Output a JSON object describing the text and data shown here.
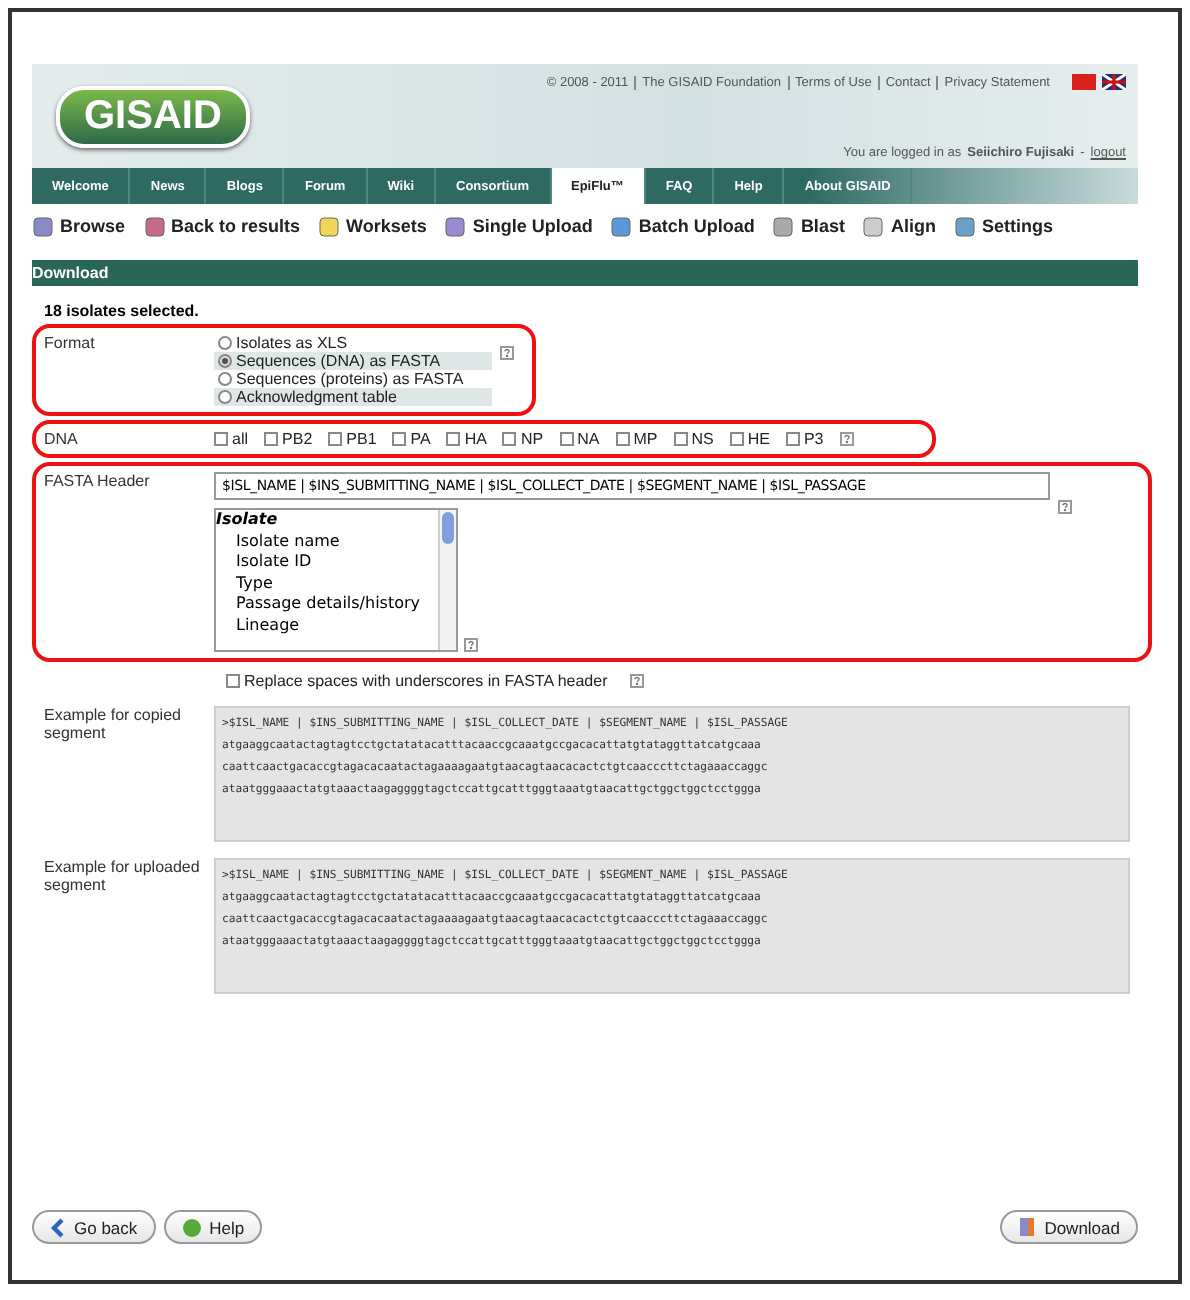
{
  "header": {
    "logo": "GISAID",
    "copyright": "© 2008 - 2011",
    "links": [
      "The GISAID Foundation",
      "Terms of Use",
      "Contact",
      "Privacy Statement"
    ],
    "login_prefix": "You are logged in as",
    "user": "Seiichiro Fujisaki",
    "login_separator": "-",
    "logout": "logout"
  },
  "nav_tabs": [
    {
      "label": "Welcome",
      "selected": false
    },
    {
      "label": "News",
      "selected": false
    },
    {
      "label": "Blogs",
      "selected": false
    },
    {
      "label": "Forum",
      "selected": false
    },
    {
      "label": "Wiki",
      "selected": false
    },
    {
      "label": "Consortium",
      "selected": false
    },
    {
      "label": "EpiFlu™",
      "selected": true
    },
    {
      "label": "FAQ",
      "selected": false
    },
    {
      "label": "Help",
      "selected": false
    },
    {
      "label": "About GISAID",
      "selected": false
    }
  ],
  "toolbar": [
    {
      "label": "Browse",
      "kind": "browse"
    },
    {
      "label": "Back to results",
      "kind": "back"
    },
    {
      "label": "Worksets",
      "kind": "folder"
    },
    {
      "label": "Single Upload",
      "kind": "upload"
    },
    {
      "label": "Batch Upload",
      "kind": "batch"
    },
    {
      "label": "Blast",
      "kind": "blast"
    },
    {
      "label": "Align",
      "kind": "align"
    },
    {
      "label": "Settings",
      "kind": "settings"
    }
  ],
  "section_title": "Download",
  "selection_count": "18 isolates selected.",
  "format": {
    "label": "Format",
    "options": [
      {
        "label": "Isolates as XLS",
        "selected": false
      },
      {
        "label": "Sequences (DNA) as FASTA",
        "selected": true
      },
      {
        "label": "Sequences (proteins) as FASTA",
        "selected": false
      },
      {
        "label": "Acknowledgment table",
        "selected": false
      }
    ]
  },
  "dna": {
    "label": "DNA",
    "segments": [
      {
        "label": "all",
        "checked": false
      },
      {
        "label": "PB2",
        "checked": false
      },
      {
        "label": "PB1",
        "checked": false
      },
      {
        "label": "PA",
        "checked": false
      },
      {
        "label": "HA",
        "checked": false
      },
      {
        "label": "NP",
        "checked": false
      },
      {
        "label": "NA",
        "checked": false
      },
      {
        "label": "MP",
        "checked": false
      },
      {
        "label": "NS",
        "checked": false
      },
      {
        "label": "HE",
        "checked": false
      },
      {
        "label": "P3",
        "checked": false
      }
    ]
  },
  "fasta_header": {
    "label": "FASTA Header",
    "value": "$ISL_NAME  | $INS_SUBMITTING_NAME  | $ISL_COLLECT_DATE  | $SEGMENT_NAME  | $ISL_PASSAGE",
    "list_group": "Isolate",
    "list_items": [
      "Isolate name",
      "Isolate ID",
      "Type",
      "Passage details/history",
      "Lineage"
    ]
  },
  "replace_spaces": {
    "label": "Replace spaces with underscores in FASTA header",
    "checked": false
  },
  "examples": [
    {
      "label": "Example for copied segment",
      "lines": [
        ">$ISL_NAME | $INS_SUBMITTING_NAME | $ISL_COLLECT_DATE | $SEGMENT_NAME | $ISL_PASSAGE",
        "atgaaggcaatactagtagtcctgctatatacatttacaaccgcaaatgccgacacattatgtataggttatcatgcaaa",
        "caattcaactgacaccgtagacacaatactagaaaagaatgtaacagtaacacactctgtcaacccttctagaaaccaggc",
        "ataatgggaaactatgtaaactaagaggggtagctccattgcatttgggtaaatgtaacattgctggctggctcctggga"
      ]
    },
    {
      "label": "Example for uploaded segment",
      "lines": [
        ">$ISL_NAME | $INS_SUBMITTING_NAME | $ISL_COLLECT_DATE | $SEGMENT_NAME | $ISL_PASSAGE",
        "atgaaggcaatactagtagtcctgctatatacatttacaaccgcaaatgccgacacattatgtataggttatcatgcaaa",
        "caattcaactgacaccgtagacacaatactagaaaagaatgtaacagtaacacactctgtcaacccttctagaaaccaggc",
        "ataatgggaaactatgtaaactaagaggggtagctccattgcatttgggtaaatgtaacattgctggctggctcctggga"
      ]
    }
  ],
  "buttons": [
    {
      "label": "Go back",
      "kind": "back"
    },
    {
      "label": "Help",
      "kind": "help"
    },
    {
      "label": "Download",
      "kind": "download"
    }
  ]
}
